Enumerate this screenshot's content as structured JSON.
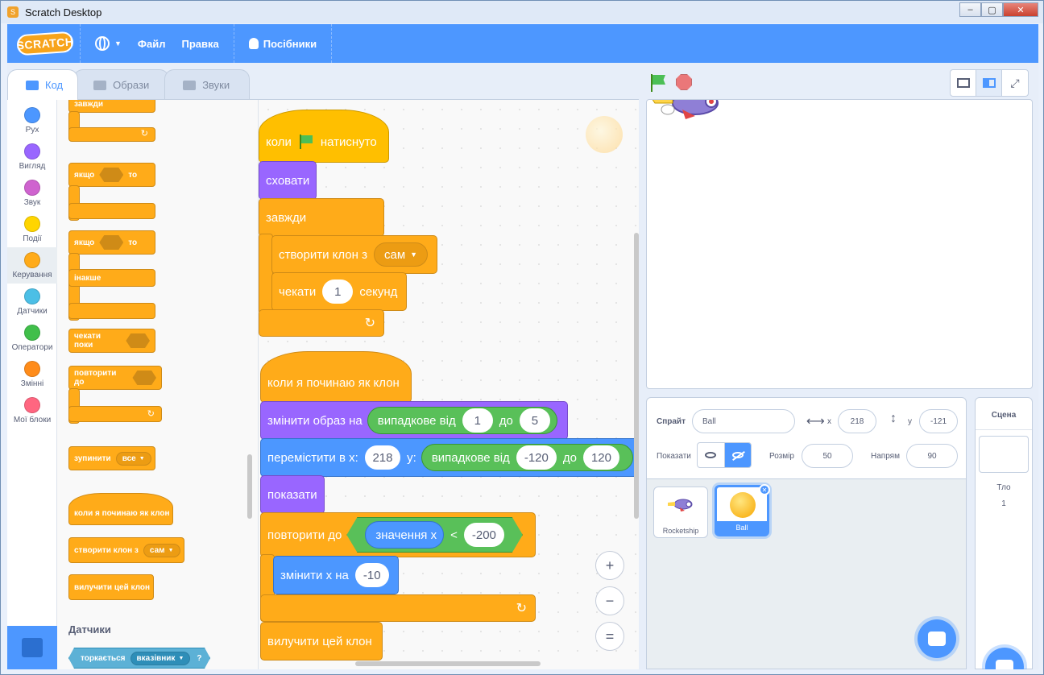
{
  "window": {
    "title": "Scratch Desktop",
    "controls": [
      "–",
      "▢",
      "✕"
    ]
  },
  "menubar": {
    "logo": "SCRATCH",
    "file": "Файл",
    "edit": "Правка",
    "tutorials": "Посібники"
  },
  "tabs": [
    "Код",
    "Образи",
    "Звуки"
  ],
  "categories": [
    "Рух",
    "Вигляд",
    "Звук",
    "Події",
    "Керування",
    "Датчики",
    "Оператори",
    "Змінні",
    "Мої блоки"
  ],
  "category_colors": [
    "#4c97ff",
    "#9966ff",
    "#cf63cf",
    "#ffd500",
    "#ffab19",
    "#4cbfe6",
    "#40bf4a",
    "#ff8c1a",
    "#ff6680"
  ],
  "palette": {
    "forever_top": "завжди",
    "if_then_if": "якщо",
    "if_then_then": "то",
    "if_else_if": "якщо",
    "if_else_then": "то",
    "if_else_else": "інакше",
    "wait_until": "чекати поки",
    "repeat_until": "повторити до",
    "stop": "зупинити",
    "stop_option": "все",
    "when_clone": "коли я починаю як клон",
    "create_clone": "створити клон з",
    "create_clone_option": "сам",
    "delete_clone": "вилучити цей клон",
    "sensing_section": "Датчики",
    "touching": "торкається",
    "touching_option": "вказівник",
    "touching_q": "?"
  },
  "script1": {
    "hat_when": "коли",
    "hat_clicked": "натиснуто",
    "hide": "сховати",
    "forever": "завжди",
    "create_clone": "створити клон з",
    "create_clone_option": "сам",
    "wait": "чекати",
    "wait_value": "1",
    "wait_unit": "секунд"
  },
  "script2": {
    "hat": "коли я починаю як клон",
    "switch_costume": "змінити образ на",
    "random": "випадкове від",
    "rand_from": "1",
    "rand_to_word": "до",
    "rand_to": "5",
    "goto": "перемістити в х:",
    "goto_x": "218",
    "goto_y_label": "у:",
    "random2": "випадкове від",
    "rand2_from": "-120",
    "rand2_to_word": "до",
    "rand2_to": "120",
    "show": "показати",
    "repeat_until": "повторити до",
    "x_position": "значення x",
    "lt": "<",
    "lt_value": "-200",
    "change_x": "змінити х на",
    "change_x_value": "-10",
    "delete_clone": "вилучити цей клон"
  },
  "zoom": {
    "in": "+",
    "out": "−",
    "reset": "="
  },
  "sprite_info": {
    "sprite_label": "Спрайт",
    "sprite_name": "Ball",
    "x_label": "x",
    "x": "218",
    "y_label": "y",
    "y": "-121",
    "show_label": "Показати",
    "size_label": "Розмір",
    "size": "50",
    "direction_label": "Напрям",
    "direction": "90"
  },
  "sprites": [
    {
      "name": "Rocketship",
      "selected": false
    },
    {
      "name": "Ball",
      "selected": true
    }
  ],
  "stage_pane": {
    "title": "Сцена",
    "backdrops_label": "Тло",
    "backdrops_count": "1"
  }
}
